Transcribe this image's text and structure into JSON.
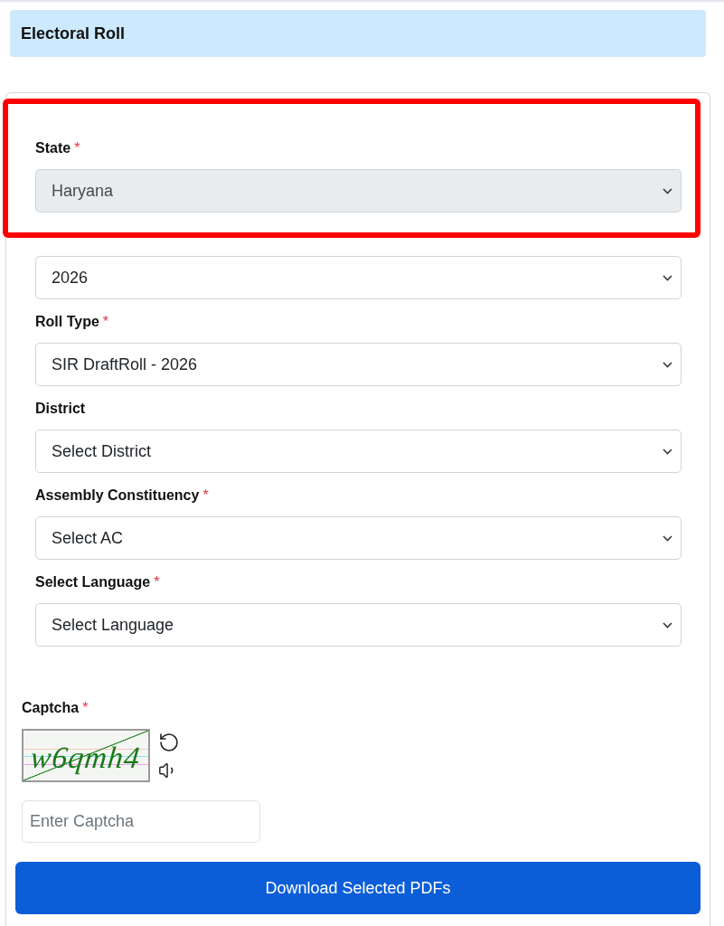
{
  "page": {
    "title": "Electoral Roll"
  },
  "form": {
    "fields": [
      {
        "kind": "select",
        "label": "State",
        "required_mark": "*",
        "value": "Haryana",
        "disabled": true,
        "highlighted": true
      },
      {
        "kind": "select",
        "value": "2026",
        "disabled": false,
        "highlighted": false
      },
      {
        "kind": "select",
        "label": "Roll Type",
        "required_mark": "*",
        "value": "SIR DraftRoll - 2026",
        "disabled": false,
        "highlighted": false
      },
      {
        "kind": "select",
        "label": "District",
        "value": "Select District",
        "disabled": false,
        "highlighted": false
      },
      {
        "kind": "select",
        "label": "Assembly Constituency",
        "required_mark": "*",
        "value": "Select AC",
        "disabled": false,
        "highlighted": false
      },
      {
        "kind": "select",
        "label": "Select Language",
        "required_mark": "*",
        "value": "Select Language",
        "disabled": false,
        "highlighted": false
      }
    ],
    "captcha": {
      "label": "Captcha",
      "required_mark": "*",
      "code": "w6qmh4",
      "placeholder": "Enter Captcha"
    },
    "submit_button": {
      "label": "Download Selected PDFs"
    }
  }
}
